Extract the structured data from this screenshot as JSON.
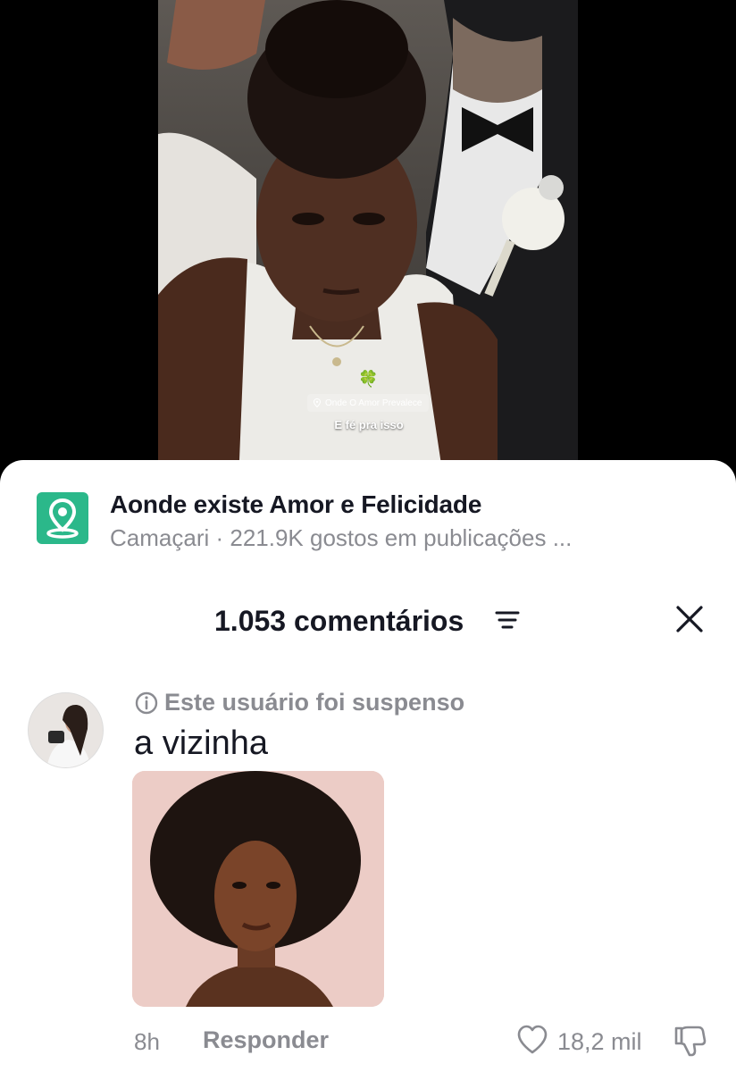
{
  "video": {
    "location_chip": "Onde O Amor Prevalece",
    "caption": "E fé pra isso",
    "clover": "🍀"
  },
  "place": {
    "icon": "location-pin-icon",
    "title": "Aonde existe Amor e Felicidade",
    "subtitle": "Camaçari · 221.9K gostos em publicações ..."
  },
  "comments": {
    "count_label": "1.053 comentários",
    "sort_icon": "sort-icon",
    "close_icon": "close-icon"
  },
  "comment": {
    "suspended_notice": "Este usuário foi suspenso",
    "text": "a vizinha",
    "time": "8h",
    "reply_label": "Responder",
    "likes": "18,2 mil"
  },
  "colors": {
    "accent_green": "#2bb88a",
    "text_primary": "#161823",
    "text_secondary": "#8a8b91"
  }
}
